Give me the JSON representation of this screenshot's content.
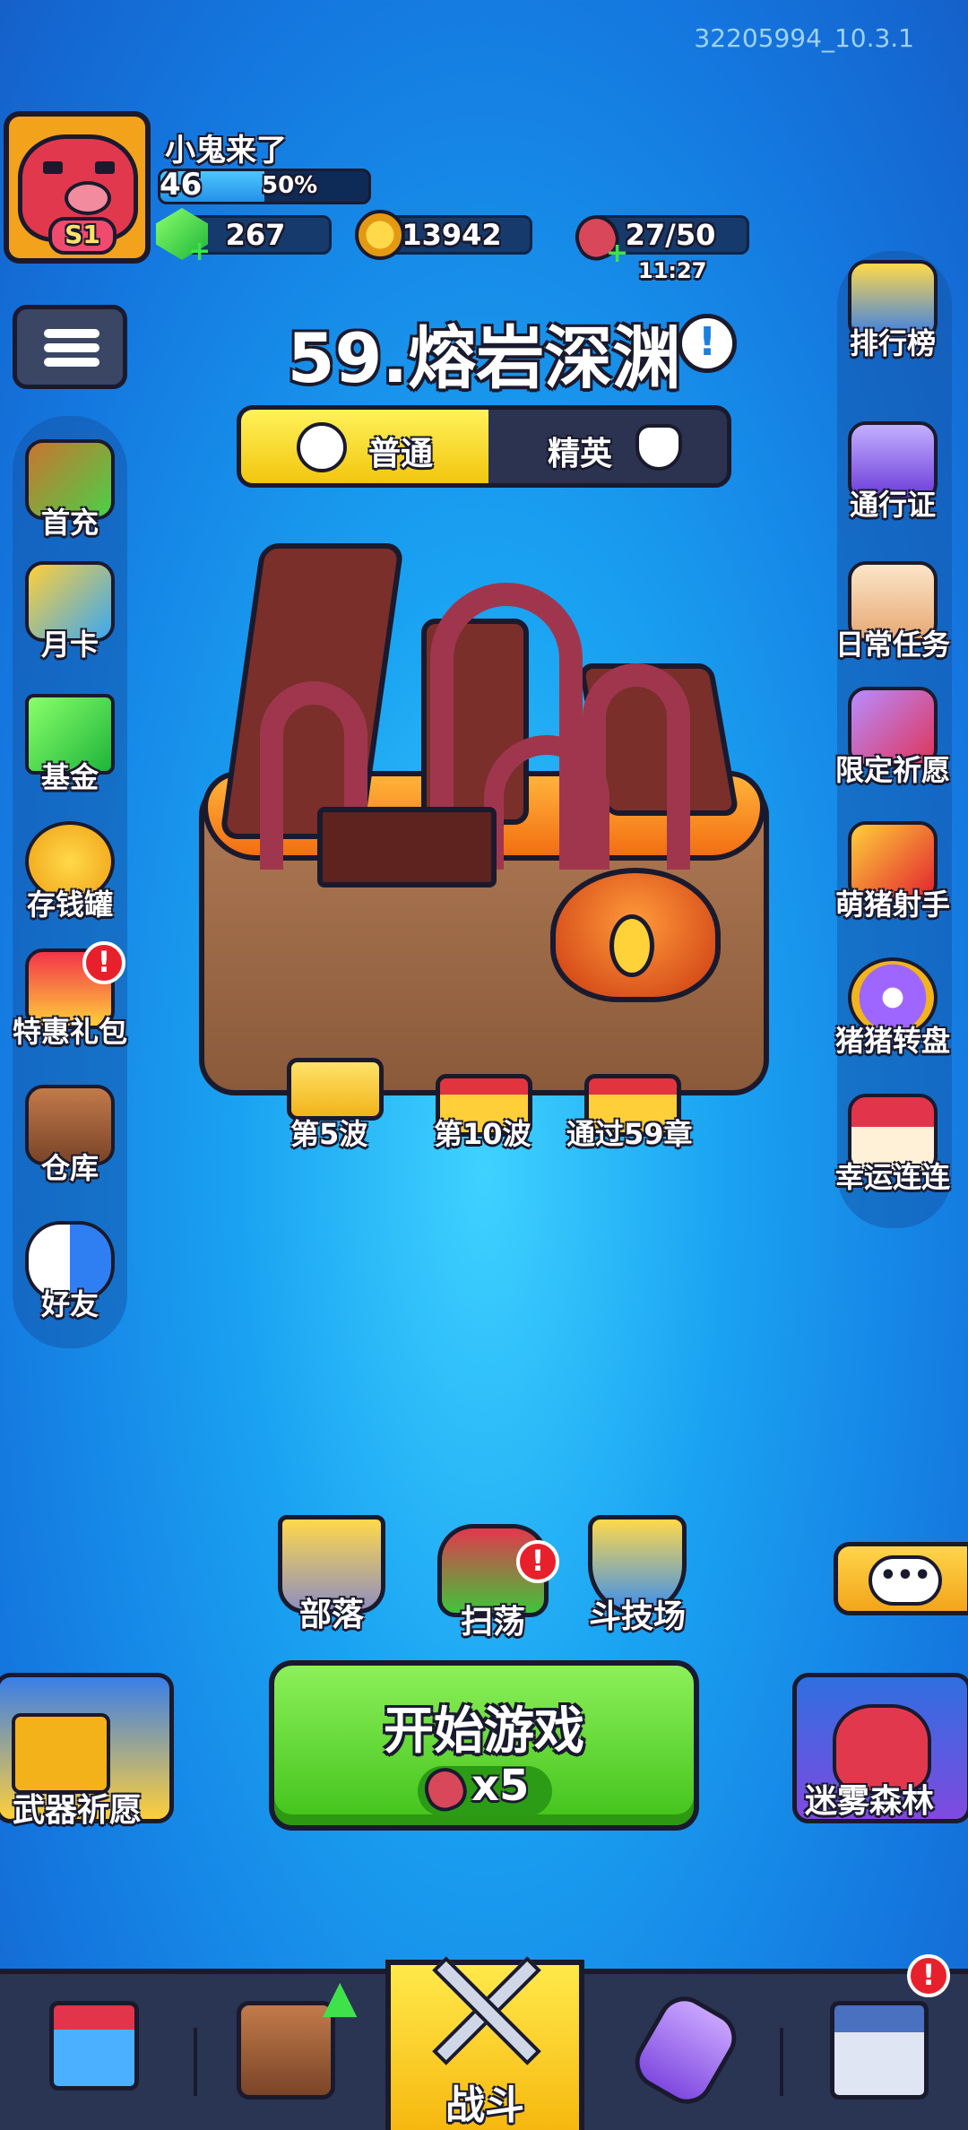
{
  "build": "32205994_10.3.1",
  "player": {
    "name": "小鬼来了",
    "level": "46",
    "level_progress": 0.5,
    "level_pct_label": "50%",
    "season": "S1"
  },
  "resources": {
    "gems": "267",
    "coins": "13942",
    "stamina": "27/50",
    "stamina_timer": "11:27"
  },
  "level": {
    "title": "59.熔岩深渊",
    "info_glyph": "!"
  },
  "mode_tabs": [
    {
      "label": "普通",
      "selected": true
    },
    {
      "label": "精英",
      "selected": false
    }
  ],
  "left_menu": [
    {
      "label": "首充",
      "icon": "first-recharge-icon",
      "badge": null
    },
    {
      "label": "月卡",
      "icon": "monthly-card-icon",
      "badge": null
    },
    {
      "label": "基金",
      "icon": "fund-gem-icon",
      "badge": null
    },
    {
      "label": "存钱罐",
      "icon": "piggy-bank-icon",
      "badge": null
    },
    {
      "label": "特惠礼包",
      "icon": "gift-pack-icon",
      "badge": "!"
    },
    {
      "label": "仓库",
      "icon": "backpack-icon",
      "badge": null
    },
    {
      "label": "好友",
      "icon": "friends-icon",
      "badge": null
    }
  ],
  "right_menu": [
    {
      "label": "排行榜",
      "icon": "leaderboard-trophy-icon"
    },
    {
      "label": "通行证",
      "icon": "pass-badge-icon"
    },
    {
      "label": "日常任务",
      "icon": "daily-quest-scroll-icon"
    },
    {
      "label": "限定祈愿",
      "icon": "limited-wish-icon"
    },
    {
      "label": "萌猪射手",
      "icon": "pig-shooter-icon"
    },
    {
      "label": "猪猪转盘",
      "icon": "wheel-icon"
    },
    {
      "label": "幸运连连",
      "icon": "lucky-cake-icon"
    }
  ],
  "rewards": [
    {
      "label": "第5波",
      "opened": true
    },
    {
      "label": "第10波",
      "opened": false
    },
    {
      "label": "通过59章",
      "opened": false
    }
  ],
  "game_modes": [
    {
      "label": "部落",
      "icon": "tribe-castle-icon",
      "badge": null
    },
    {
      "label": "扫荡",
      "icon": "sweep-pig-icon",
      "badge": "!"
    },
    {
      "label": "斗技场",
      "icon": "arena-shield-icon",
      "badge": null
    }
  ],
  "start": {
    "label": "开始游戏",
    "cost": "x5"
  },
  "features": {
    "left": "武器祈愿",
    "right": "迷雾森林"
  },
  "chat": {
    "glyph": "•••"
  },
  "bottom_nav": [
    {
      "name": "shop",
      "icon": "shop-icon"
    },
    {
      "name": "hero",
      "icon": "hero-backpack-icon"
    },
    {
      "name": "battle",
      "label": "战斗",
      "icon": "crossed-swords-icon",
      "active": true
    },
    {
      "name": "potion",
      "icon": "potion-jar-icon"
    },
    {
      "name": "building",
      "icon": "building-icon",
      "badge": "!"
    }
  ],
  "colors": {
    "accent": "#f6c20e",
    "badge": "#e8202c",
    "start_green": "#41c21a",
    "bg": "#1aa3f2"
  }
}
